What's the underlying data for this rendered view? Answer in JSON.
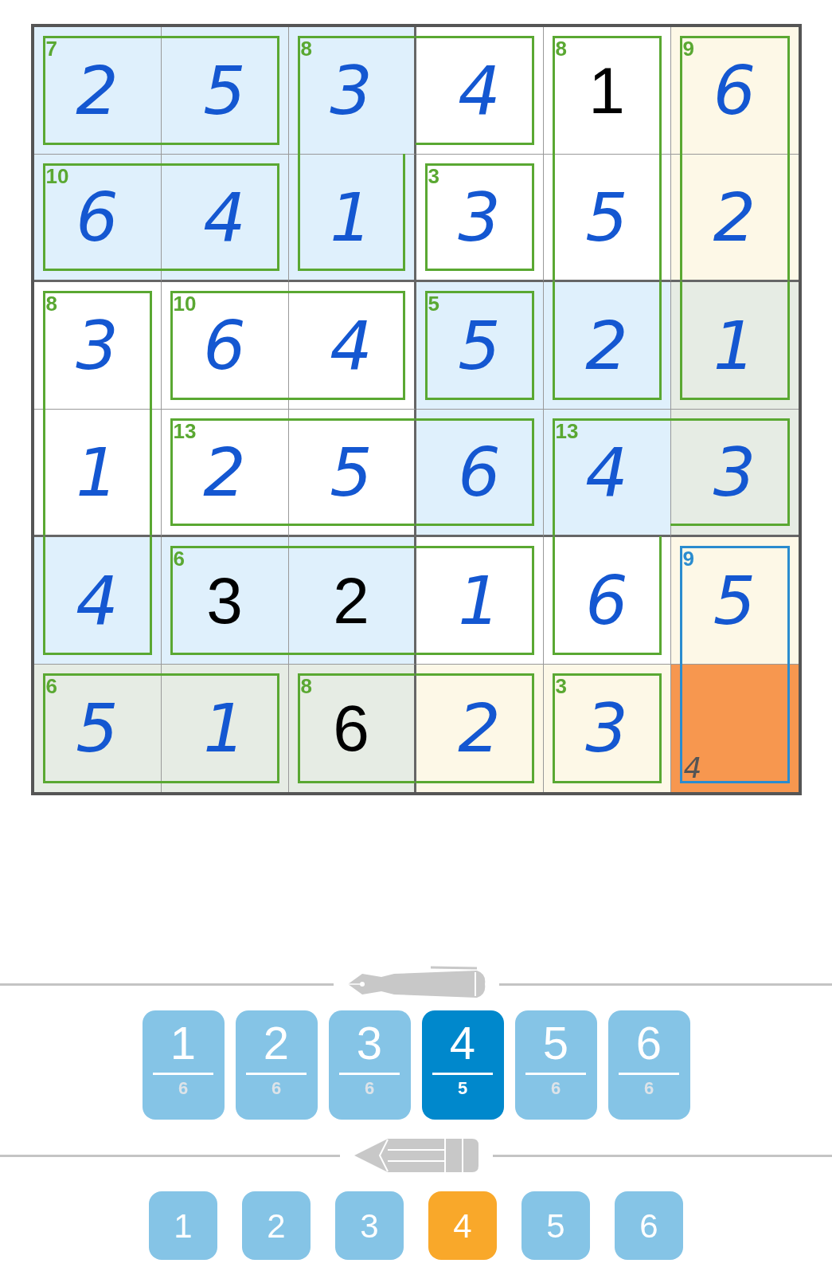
{
  "grid": {
    "rows": [
      {
        "cells": [
          {
            "value": "2",
            "kind": "entry",
            "color": "#dff0fc",
            "selected": false,
            "cage_sum": "7",
            "cage_selected": false,
            "cage_edges": {
              "top": true,
              "right": false,
              "bottom": true,
              "left": true
            }
          },
          {
            "value": "5",
            "kind": "entry",
            "color": "#dff0fc",
            "selected": false,
            "cage_selected": false,
            "cage_edges": {
              "top": true,
              "right": true,
              "bottom": true,
              "left": false
            }
          },
          {
            "value": "3",
            "kind": "entry",
            "color": "#dff0fc",
            "selected": false,
            "cage_sum": "8",
            "cage_selected": false,
            "cage_edges": {
              "top": true,
              "right": false,
              "bottom": false,
              "left": true
            }
          },
          {
            "value": "4",
            "kind": "entry",
            "color": "#ffffff",
            "selected": false,
            "cage_selected": false,
            "cage_edges": {
              "top": true,
              "right": true,
              "bottom": true,
              "left": false
            }
          },
          {
            "value": "1",
            "kind": "given",
            "color": "#ffffff",
            "selected": false,
            "cage_sum": "8",
            "cage_selected": false,
            "cage_edges": {
              "top": true,
              "right": true,
              "bottom": false,
              "left": true
            }
          },
          {
            "value": "6",
            "kind": "entry",
            "color": "#fdf8e7",
            "selected": false,
            "cage_sum": "9",
            "cage_selected": false,
            "cage_edges": {
              "top": true,
              "right": true,
              "bottom": false,
              "left": true
            }
          }
        ]
      },
      {
        "cells": [
          {
            "value": "6",
            "kind": "entry",
            "color": "#dff0fc",
            "selected": false,
            "cage_sum": "10",
            "cage_selected": false,
            "cage_edges": {
              "top": true,
              "right": false,
              "bottom": true,
              "left": true
            }
          },
          {
            "value": "4",
            "kind": "entry",
            "color": "#dff0fc",
            "selected": false,
            "cage_selected": false,
            "cage_edges": {
              "top": true,
              "right": true,
              "bottom": true,
              "left": false
            }
          },
          {
            "value": "1",
            "kind": "entry",
            "color": "#dff0fc",
            "selected": false,
            "cage_selected": false,
            "cage_edges": {
              "top": false,
              "right": true,
              "bottom": true,
              "left": true
            }
          },
          {
            "value": "3",
            "kind": "entry",
            "color": "#ffffff",
            "selected": false,
            "cage_sum": "3",
            "cage_selected": false,
            "cage_edges": {
              "top": true,
              "right": true,
              "bottom": true,
              "left": true
            }
          },
          {
            "value": "5",
            "kind": "entry",
            "color": "#ffffff",
            "selected": false,
            "cage_selected": false,
            "cage_edges": {
              "top": false,
              "right": true,
              "bottom": false,
              "left": true
            }
          },
          {
            "value": "2",
            "kind": "entry",
            "color": "#fdf8e7",
            "selected": false,
            "cage_selected": false,
            "cage_edges": {
              "top": false,
              "right": true,
              "bottom": false,
              "left": true
            }
          }
        ]
      },
      {
        "cells": [
          {
            "value": "3",
            "kind": "entry",
            "color": "#ffffff",
            "selected": false,
            "cage_sum": "8",
            "cage_selected": false,
            "cage_edges": {
              "top": true,
              "right": true,
              "bottom": false,
              "left": true
            }
          },
          {
            "value": "6",
            "kind": "entry",
            "color": "#ffffff",
            "selected": false,
            "cage_sum": "10",
            "cage_selected": false,
            "cage_edges": {
              "top": true,
              "right": false,
              "bottom": true,
              "left": true
            }
          },
          {
            "value": "4",
            "kind": "entry",
            "color": "#ffffff",
            "selected": false,
            "cage_selected": false,
            "cage_edges": {
              "top": true,
              "right": true,
              "bottom": true,
              "left": false
            }
          },
          {
            "value": "5",
            "kind": "entry",
            "color": "#dff0fc",
            "selected": false,
            "cage_sum": "5",
            "cage_selected": false,
            "cage_edges": {
              "top": true,
              "right": true,
              "bottom": true,
              "left": true
            }
          },
          {
            "value": "2",
            "kind": "entry",
            "color": "#dff0fc",
            "selected": false,
            "cage_selected": false,
            "cage_edges": {
              "top": false,
              "right": true,
              "bottom": true,
              "left": true
            }
          },
          {
            "value": "1",
            "kind": "entry",
            "color": "#e6ece4",
            "selected": false,
            "cage_selected": false,
            "cage_edges": {
              "top": false,
              "right": true,
              "bottom": true,
              "left": true
            }
          }
        ]
      },
      {
        "cells": [
          {
            "value": "1",
            "kind": "entry",
            "color": "#ffffff",
            "selected": false,
            "cage_selected": false,
            "cage_edges": {
              "top": false,
              "right": true,
              "bottom": false,
              "left": true
            }
          },
          {
            "value": "2",
            "kind": "entry",
            "color": "#ffffff",
            "selected": false,
            "cage_sum": "13",
            "cage_selected": false,
            "cage_edges": {
              "top": true,
              "right": false,
              "bottom": true,
              "left": true
            }
          },
          {
            "value": "5",
            "kind": "entry",
            "color": "#ffffff",
            "selected": false,
            "cage_selected": false,
            "cage_edges": {
              "top": true,
              "right": false,
              "bottom": true,
              "left": false
            }
          },
          {
            "value": "6",
            "kind": "entry",
            "color": "#dff0fc",
            "selected": false,
            "cage_selected": false,
            "cage_edges": {
              "top": true,
              "right": true,
              "bottom": true,
              "left": false
            }
          },
          {
            "value": "4",
            "kind": "entry",
            "color": "#dff0fc",
            "selected": false,
            "cage_sum": "13",
            "cage_selected": false,
            "cage_edges": {
              "top": true,
              "right": false,
              "bottom": false,
              "left": true
            }
          },
          {
            "value": "3",
            "kind": "entry",
            "color": "#e6ece4",
            "selected": false,
            "cage_selected": false,
            "cage_edges": {
              "top": true,
              "right": true,
              "bottom": true,
              "left": false
            }
          }
        ]
      },
      {
        "cells": [
          {
            "value": "4",
            "kind": "entry",
            "color": "#dff0fc",
            "selected": false,
            "cage_selected": false,
            "cage_edges": {
              "top": false,
              "right": true,
              "bottom": true,
              "left": true
            }
          },
          {
            "value": "3",
            "kind": "given",
            "color": "#dff0fc",
            "selected": false,
            "cage_sum": "6",
            "cage_selected": false,
            "cage_edges": {
              "top": true,
              "right": false,
              "bottom": true,
              "left": true
            }
          },
          {
            "value": "2",
            "kind": "given",
            "color": "#dff0fc",
            "selected": false,
            "cage_selected": false,
            "cage_edges": {
              "top": true,
              "right": false,
              "bottom": true,
              "left": false
            }
          },
          {
            "value": "1",
            "kind": "entry",
            "color": "#ffffff",
            "selected": false,
            "cage_selected": false,
            "cage_edges": {
              "top": true,
              "right": true,
              "bottom": true,
              "left": false
            }
          },
          {
            "value": "6",
            "kind": "entry",
            "color": "#ffffff",
            "selected": false,
            "cage_selected": false,
            "cage_edges": {
              "top": false,
              "right": true,
              "bottom": true,
              "left": true
            }
          },
          {
            "value": "5",
            "kind": "entry",
            "color": "#fdf8e7",
            "selected": false,
            "cage_sum": "9",
            "cage_selected": true,
            "cage_edges": {
              "top": true,
              "right": true,
              "bottom": false,
              "left": true
            }
          }
        ]
      },
      {
        "cells": [
          {
            "value": "5",
            "kind": "entry",
            "color": "#e6ece4",
            "selected": false,
            "cage_sum": "6",
            "cage_selected": false,
            "cage_edges": {
              "top": true,
              "right": false,
              "bottom": true,
              "left": true
            }
          },
          {
            "value": "1",
            "kind": "entry",
            "color": "#e6ece4",
            "selected": false,
            "cage_selected": false,
            "cage_edges": {
              "top": true,
              "right": true,
              "bottom": true,
              "left": false
            }
          },
          {
            "value": "6",
            "kind": "given",
            "color": "#e6ece4",
            "selected": false,
            "cage_sum": "8",
            "cage_selected": false,
            "cage_edges": {
              "top": true,
              "right": false,
              "bottom": true,
              "left": true
            }
          },
          {
            "value": "2",
            "kind": "entry",
            "color": "#fdf8e7",
            "selected": false,
            "cage_selected": false,
            "cage_edges": {
              "top": true,
              "right": true,
              "bottom": true,
              "left": false
            }
          },
          {
            "value": "3",
            "kind": "entry",
            "color": "#fdf8e7",
            "selected": false,
            "cage_sum": "3",
            "cage_selected": false,
            "cage_edges": {
              "top": true,
              "right": true,
              "bottom": true,
              "left": true
            }
          },
          {
            "selected": true,
            "cage_selected": true,
            "pencil_marks": [
              "4"
            ],
            "cage_edges": {
              "top": false,
              "right": true,
              "bottom": true,
              "left": true
            }
          }
        ]
      }
    ]
  },
  "pen_pad": {
    "buttons": [
      {
        "digit": "1",
        "remaining": "6",
        "selected": false
      },
      {
        "digit": "2",
        "remaining": "6",
        "selected": false
      },
      {
        "digit": "3",
        "remaining": "6",
        "selected": false
      },
      {
        "digit": "4",
        "remaining": "5",
        "selected": true
      },
      {
        "digit": "5",
        "remaining": "6",
        "selected": false
      },
      {
        "digit": "6",
        "remaining": "6",
        "selected": false
      }
    ]
  },
  "pencil_pad": {
    "buttons": [
      {
        "digit": "1",
        "selected": false
      },
      {
        "digit": "2",
        "selected": false
      },
      {
        "digit": "3",
        "selected": false
      },
      {
        "digit": "4",
        "selected": true
      },
      {
        "digit": "5",
        "selected": false
      },
      {
        "digit": "6",
        "selected": false
      }
    ]
  }
}
